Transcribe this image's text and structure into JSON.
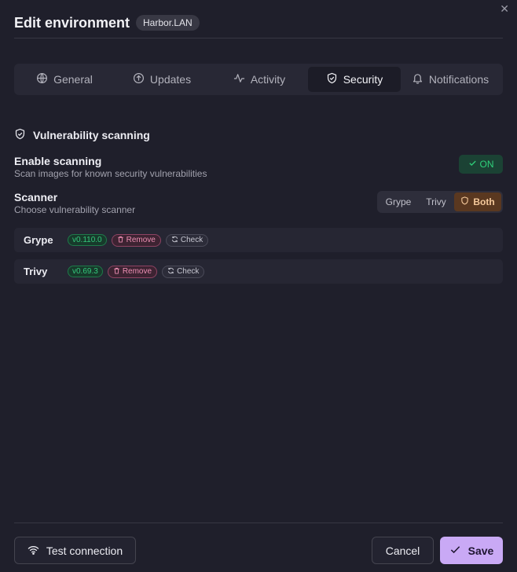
{
  "header": {
    "title": "Edit environment",
    "env_badge": "Harbor.LAN",
    "close_glyph": "✕"
  },
  "tabs": [
    {
      "label": "General",
      "icon": "globe-icon",
      "active": false
    },
    {
      "label": "Updates",
      "icon": "circle-arrow-up-icon",
      "active": false
    },
    {
      "label": "Activity",
      "icon": "activity-icon",
      "active": false
    },
    {
      "label": "Security",
      "icon": "shield-icon",
      "active": true
    },
    {
      "label": "Notifications",
      "icon": "bell-icon",
      "active": false
    }
  ],
  "section": {
    "title": "Vulnerability scanning",
    "icon": "shield-check-icon"
  },
  "enable_scanning": {
    "label": "Enable scanning",
    "description": "Scan images for known security vulnerabilities",
    "toggle_label": "ON",
    "enabled": true
  },
  "scanner": {
    "label": "Scanner",
    "description": "Choose vulnerability scanner",
    "options": [
      "Grype",
      "Trivy",
      "Both"
    ],
    "selected": "Both"
  },
  "scanners": [
    {
      "name": "Grype",
      "version": "v0.110.0",
      "remove_label": "Remove",
      "check_label": "Check"
    },
    {
      "name": "Trivy",
      "version": "v0.69.3",
      "remove_label": "Remove",
      "check_label": "Check"
    }
  ],
  "footer": {
    "test_label": "Test connection",
    "cancel_label": "Cancel",
    "save_label": "Save"
  },
  "colors": {
    "background": "#1f1f2b",
    "accent_save": "#c9a9f5",
    "toggle_on": "#2fd07a",
    "scanner_selected": "#5a3820"
  }
}
